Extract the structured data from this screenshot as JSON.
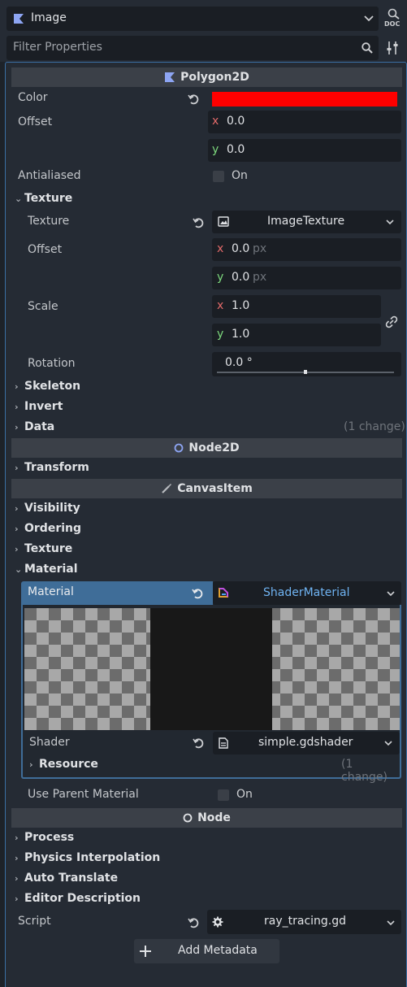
{
  "header": {
    "node_type": "Image",
    "filter_placeholder": "Filter Properties",
    "doc_label": "DOC"
  },
  "polygon2d": {
    "title": "Polygon2D",
    "color_label": "Color",
    "color_value": "#ff0000",
    "offset_label": "Offset",
    "offset_x": "0.0",
    "offset_y": "0.0",
    "antialiased_label": "Antialiased",
    "antialiased_value": "On"
  },
  "texture_group": {
    "label": "Texture",
    "texture_label": "Texture",
    "texture_value": "ImageTexture",
    "offset_label": "Offset",
    "offset_x": "0.0",
    "offset_y": "0.0",
    "unit": "px",
    "scale_label": "Scale",
    "scale_x": "1.0",
    "scale_y": "1.0",
    "rotation_label": "Rotation",
    "rotation_value": "0.0 °",
    "rotation_slider_fraction": 0.5
  },
  "groups_a": [
    {
      "label": "Skeleton"
    },
    {
      "label": "Invert"
    },
    {
      "label": "Data",
      "note": "(1 change)"
    }
  ],
  "node2d": {
    "title": "Node2D",
    "transform_label": "Transform"
  },
  "canvasitem": {
    "title": "CanvasItem",
    "groups": [
      "Visibility",
      "Ordering",
      "Texture"
    ],
    "material_group": "Material"
  },
  "material": {
    "label": "Material",
    "value": "ShaderMaterial",
    "shader_label": "Shader",
    "shader_value": "simple.gdshader",
    "resource_label": "Resource",
    "resource_note": "(1 change)",
    "use_parent_label": "Use Parent Material",
    "use_parent_value": "On"
  },
  "node": {
    "title": "Node",
    "groups": [
      "Process",
      "Physics Interpolation",
      "Auto Translate",
      "Editor Description"
    ],
    "script_label": "Script",
    "script_value": "ray_tracing.gd",
    "add_metadata_label": "Add Metadata"
  },
  "colors": {
    "accent": "#3b6fa5",
    "background": "#1d2229",
    "panel": "#252b34"
  }
}
